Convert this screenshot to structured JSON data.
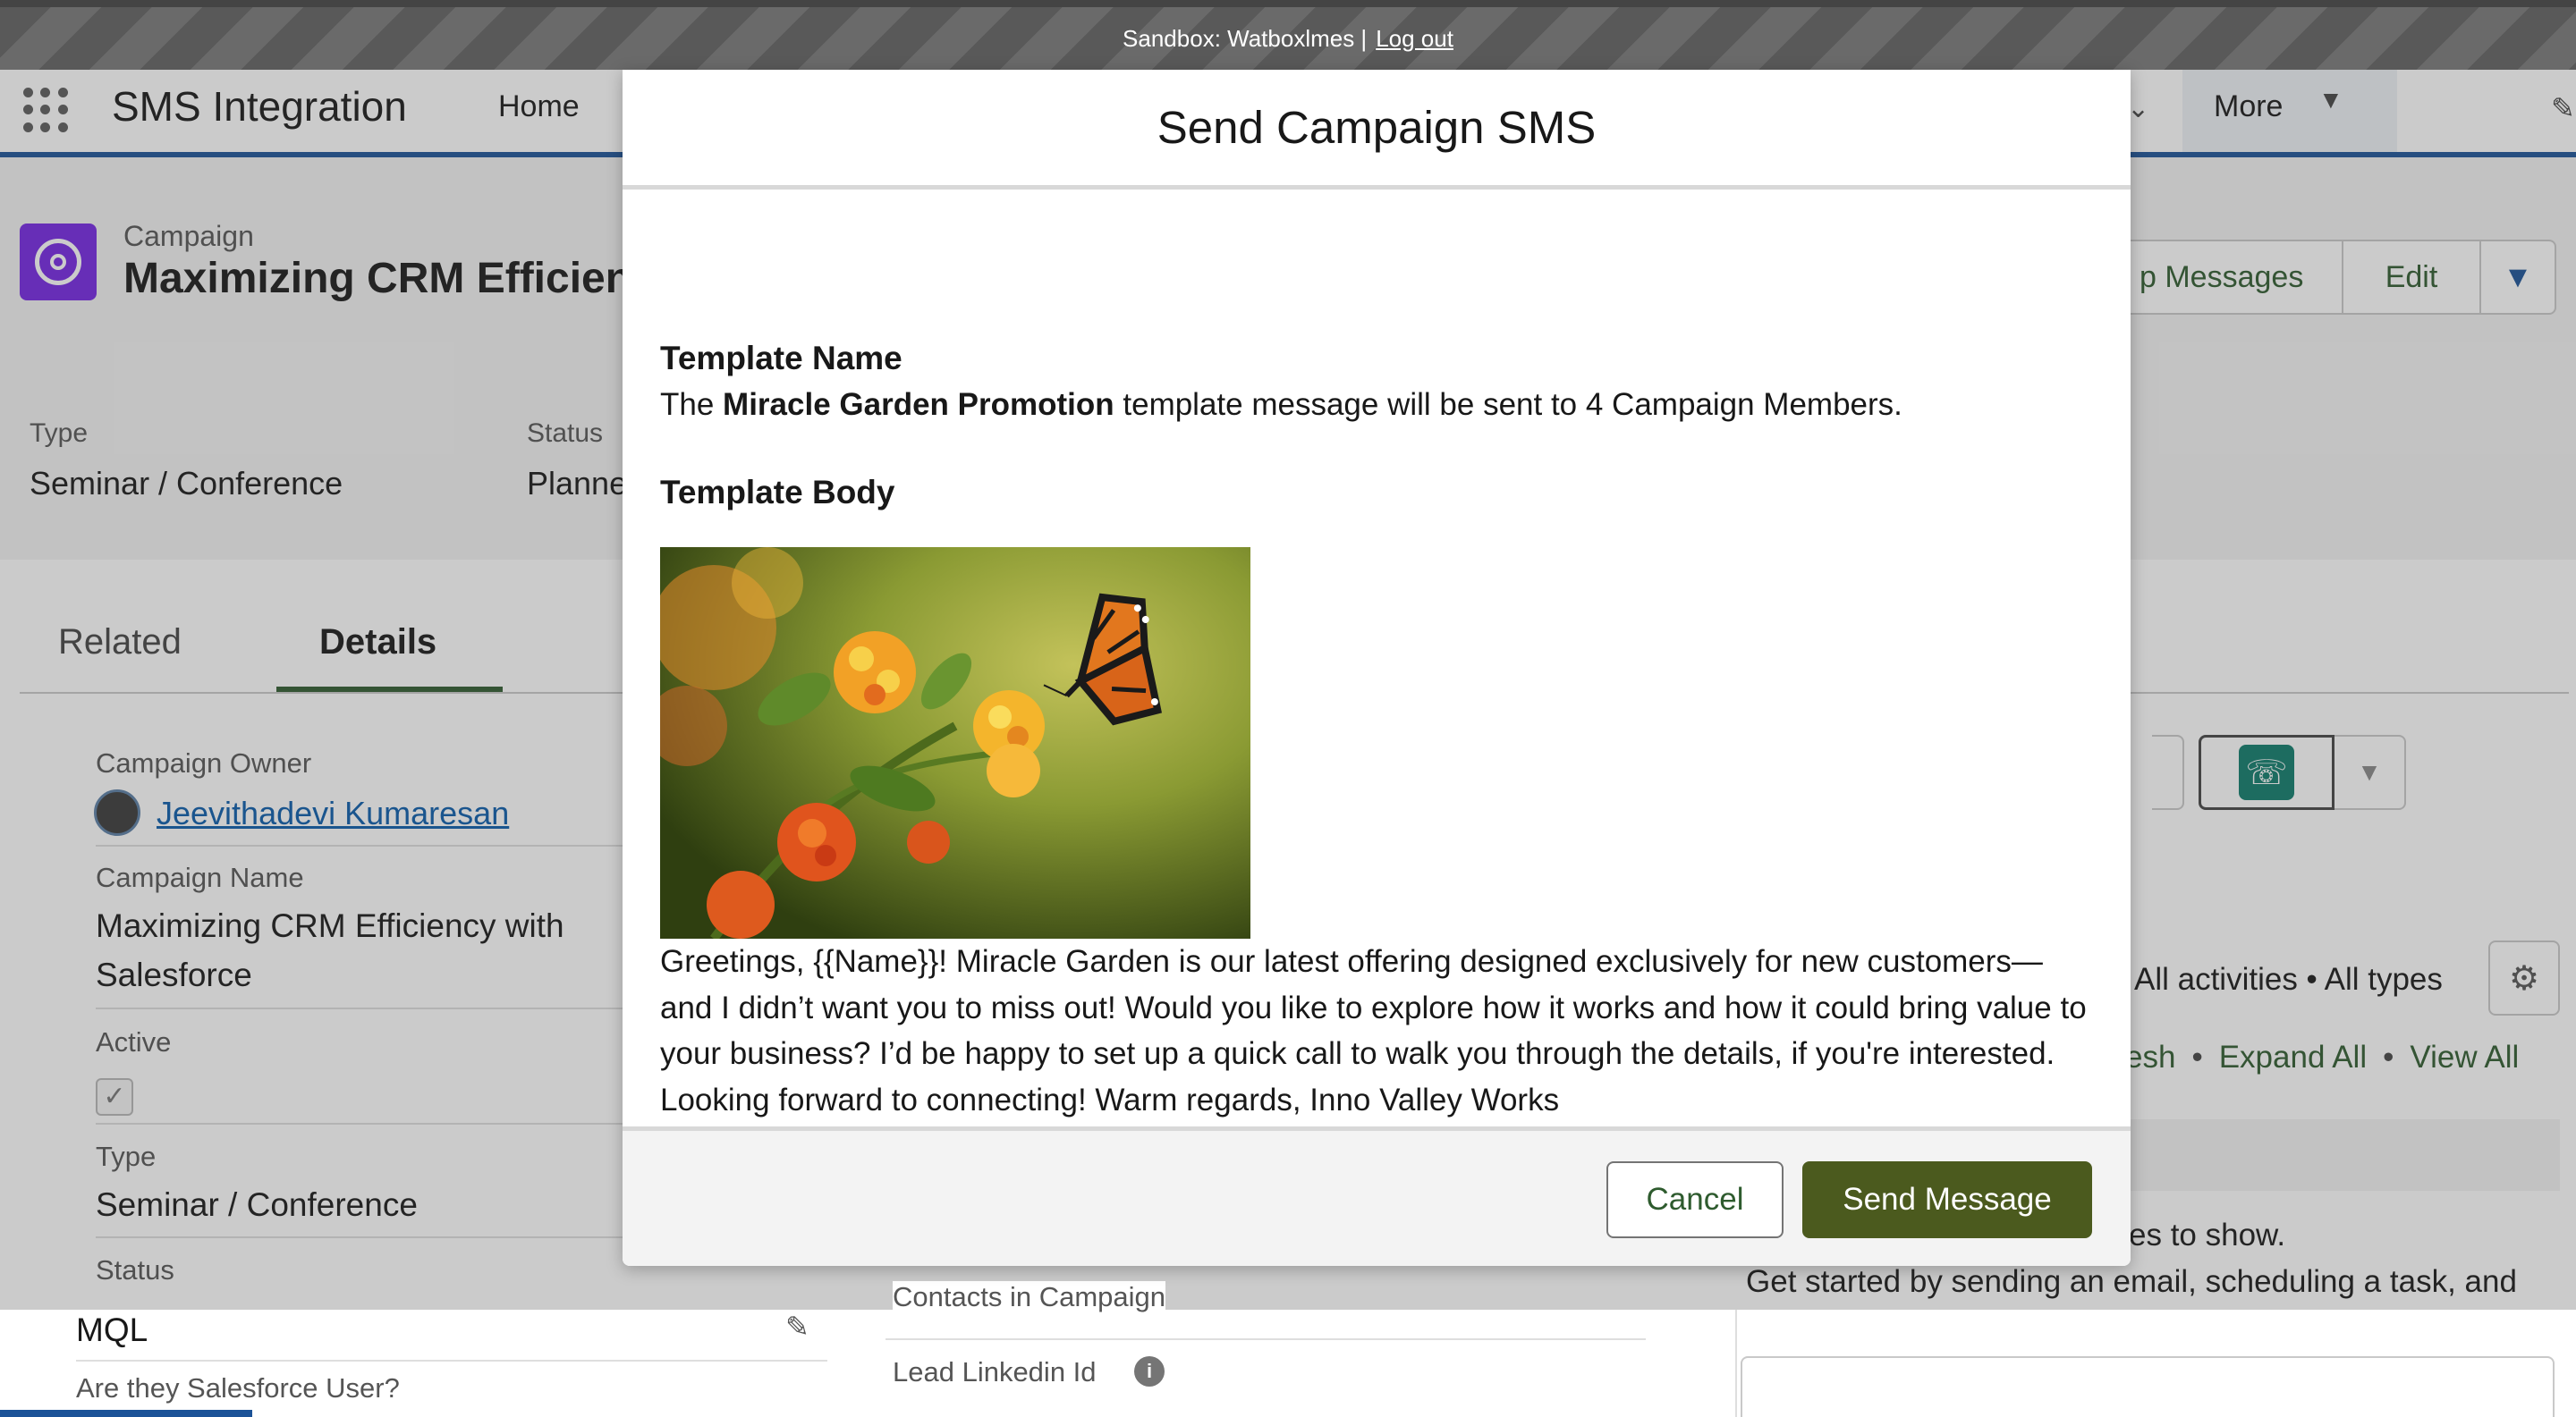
{
  "sandbox": {
    "label": "Sandbox: Watboxlmes |",
    "logout": "Log out"
  },
  "nav": {
    "app_name": "SMS Integration",
    "home": "Home",
    "more": "More"
  },
  "record": {
    "object_type": "Campaign",
    "title": "Maximizing CRM Efficien",
    "buttons": {
      "messages": "p Messages",
      "edit": "Edit"
    },
    "highlights": [
      {
        "label": "Type",
        "value": "Seminar / Conference"
      },
      {
        "label": "Status",
        "value": "Planne"
      }
    ]
  },
  "tabs": {
    "related": "Related",
    "details": "Details"
  },
  "details": {
    "owner_label": "Campaign Owner",
    "owner_name": "Jeevithadevi Kumaresan",
    "name_label": "Campaign Name",
    "name_line1": "Maximizing CRM Efficiency with",
    "name_line2": "Salesforce",
    "active_label": "Active",
    "type_label": "Type",
    "type_value": "Seminar / Conference",
    "status_label": "Status",
    "mql_value": "MQL",
    "sf_user_label": "Are they Salesforce User?",
    "contacts_label": "Contacts in Campaign",
    "lead_linkedin_label": "Lead Linkedin Id"
  },
  "activity": {
    "filter": "All activities • All types",
    "refresh": "esh",
    "expand_all": "Expand All",
    "view_all": "View All",
    "dot": "•",
    "empty_partial": "es to show.",
    "empty_line2": "Get started by sending an email, scheduling a task, and"
  },
  "modal": {
    "title": "Send Campaign SMS",
    "template_name_heading": "Template Name",
    "sentence_prefix": "The",
    "template_name": "Miracle Garden Promotion",
    "sentence_suffix": "template message will be sent to 4 Campaign Members.",
    "template_body_heading": "Template Body",
    "body_text": "Greetings, {{Name}}! Miracle Garden is our latest offering designed exclusively for new customers—and I didn’t want you to miss out! Would you like to explore how it works and how it could bring value to your business? I’d be happy to set up a quick call to walk you through the details, if you're interested. Looking forward to connecting! Warm regards, Inno Valley Works",
    "cancel": "Cancel",
    "send": "Send Message"
  },
  "icons": {
    "waffle": "app-launcher-icon",
    "campaign": "campaign-target-icon",
    "phone": "phone-icon",
    "gear": "gear-icon",
    "info": "info-icon"
  },
  "colors": {
    "brand_blue": "#1b5297",
    "send_button": "#4b5a1e",
    "campaign_icon": "#7526e3",
    "link": "#0b5cab"
  }
}
